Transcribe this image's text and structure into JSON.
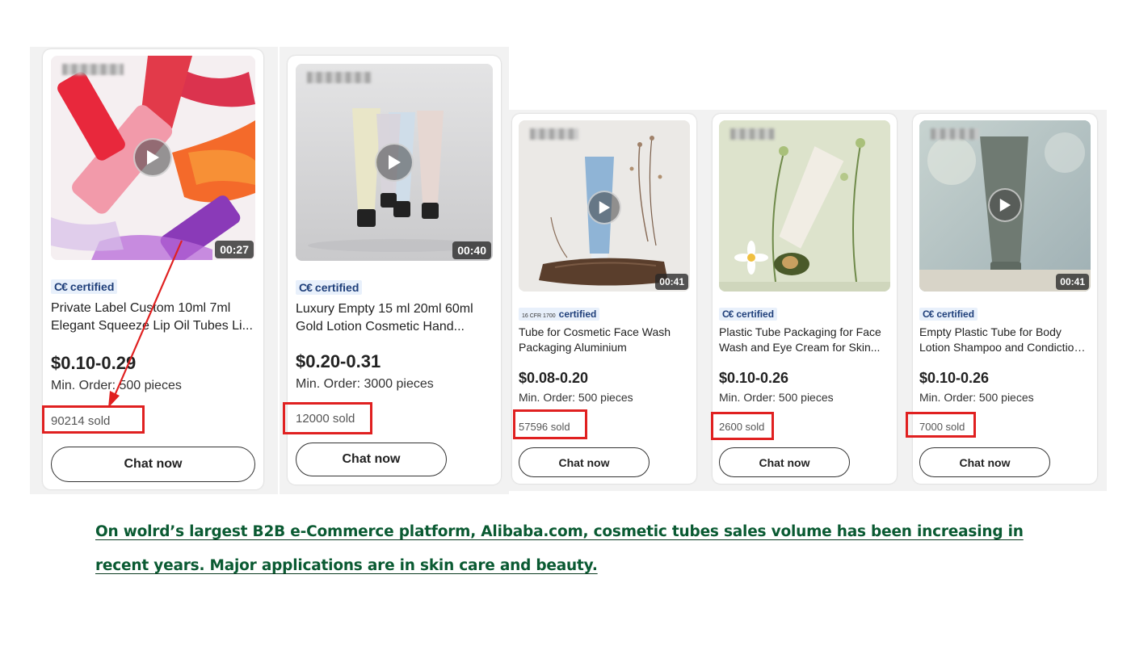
{
  "colors": {
    "highlight": "#e02020",
    "caption": "#0a5a32",
    "cert_bg": "#e8f0fb",
    "cert_text": "#1f3f7a"
  },
  "cards": [
    {
      "image": "lip-oil-tubes-image",
      "duration": "00:27",
      "cert_prefix": "C€",
      "cert_label": "certified",
      "title_line1": "Private Label Custom 10ml 7ml",
      "title_line2": "Elegant Squeeze Lip Oil Tubes Li...",
      "price": "$0.10-0.29",
      "min_order": "Min. Order: 500 pieces",
      "sold": "90214 sold",
      "chat_label": "Chat now"
    },
    {
      "image": "pastel-lotion-tubes-image",
      "duration": "00:40",
      "cert_prefix": "C€",
      "cert_label": "certified",
      "title_line1": "Luxury Empty 15 ml 20ml 60ml",
      "title_line2": "Gold Lotion Cosmetic Hand...",
      "price": "$0.20-0.31",
      "min_order": "Min. Order: 3000 pieces",
      "sold": "12000 sold",
      "chat_label": "Chat now"
    },
    {
      "image": "blue-face-wash-tube-image",
      "duration": "00:41",
      "cert_prefix": "16 CFR 1700",
      "cert_label": "certified",
      "title_line1": "Tube for Cosmetic Face Wash",
      "title_line2": "Packaging Aluminium",
      "price": "$0.08-0.20",
      "min_order": "Min. Order: 500 pieces",
      "sold": "57596 sold",
      "chat_label": "Chat now"
    },
    {
      "image": "white-face-wash-tube-image",
      "duration": "",
      "cert_prefix": "C€",
      "cert_label": "certified",
      "title_line1": "Plastic Tube Packaging for Face",
      "title_line2": "Wash and Eye Cream for Skin...",
      "price": "$0.10-0.26",
      "min_order": "Min. Order: 500 pieces",
      "sold": "2600 sold",
      "chat_label": "Chat now"
    },
    {
      "image": "grey-body-lotion-tube-image",
      "duration": "00:41",
      "cert_prefix": "C€",
      "cert_label": "certified",
      "title_line1": "Empty Plastic Tube for Body",
      "title_line2": "Lotion Shampoo and Condictione...",
      "price": "$0.10-0.26",
      "min_order": "Min. Order: 500 pieces",
      "sold": "7000 sold",
      "chat_label": "Chat now"
    }
  ],
  "caption": {
    "line1": "On wolrd’s largest B2B  e-Commerce platform, Alibaba.com, cosmetic tubes sales volume has been increasing in ",
    "line2": "recent years. Major applications are in skin care and beauty. "
  }
}
